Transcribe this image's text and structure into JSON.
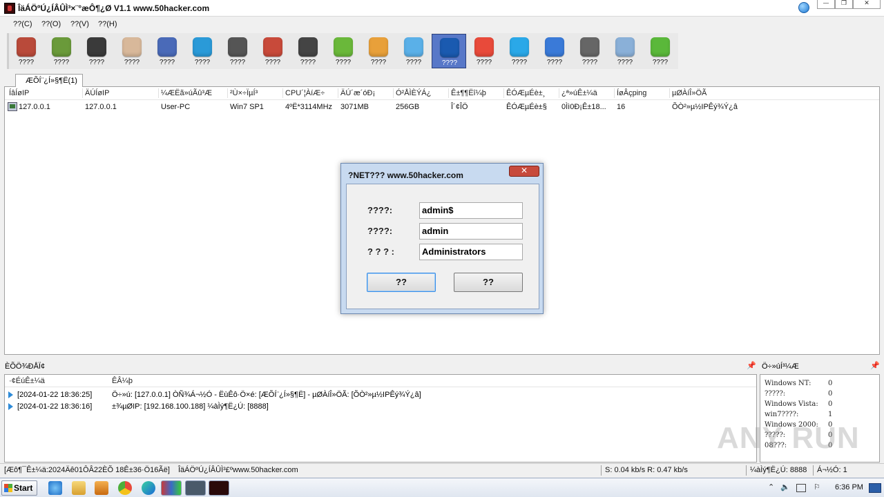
{
  "window": {
    "title": "ÎäÁÖºÚ¿ÍÂÛÌ³×¨°æÔ¶¿Ø V1.1 www.50hacker.com",
    "minimize": "—",
    "maximize": "❐",
    "close": "✕"
  },
  "menu": [
    "??(C)",
    "??(O)",
    "??(V)",
    "??(H)"
  ],
  "toolbar": {
    "items": [
      {
        "label": "????",
        "icon": "font-icon",
        "color": "#b94a3a"
      },
      {
        "label": "????",
        "icon": "drive-icon",
        "color": "#6a9a3a"
      },
      {
        "label": "????",
        "icon": "terminal-icon",
        "color": "#3a3a3a"
      },
      {
        "label": "????",
        "icon": "calculator-icon",
        "color": "#d8b89a"
      },
      {
        "label": "????",
        "icon": "activity-monitor-icon",
        "color": "#4a6ab8"
      },
      {
        "label": "????",
        "icon": "app-store-icon",
        "color": "#2a9ad8"
      },
      {
        "label": "????",
        "icon": "camera-icon",
        "color": "#555555"
      },
      {
        "label": "????",
        "icon": "microphone-icon",
        "color": "#c84a3a"
      },
      {
        "label": "????",
        "icon": "clock-icon",
        "color": "#444444"
      },
      {
        "label": "????",
        "icon": "download-icon",
        "color": "#6ab83a"
      },
      {
        "label": "????",
        "icon": "star-icon",
        "color": "#e8a03a"
      },
      {
        "label": "????",
        "icon": "cloud-icon",
        "color": "#5ab0e8"
      },
      {
        "label": "????",
        "icon": "chat-icon",
        "color": "#1a5ab0",
        "selected": true
      },
      {
        "label": "????",
        "icon": "calendar-icon",
        "color": "#e84a3a"
      },
      {
        "label": "????",
        "icon": "skype-icon",
        "color": "#2aa8e8"
      },
      {
        "label": "????",
        "icon": "globe-icon",
        "color": "#3a7ad8"
      },
      {
        "label": "????",
        "icon": "settings-icon",
        "color": "#666666"
      },
      {
        "label": "????",
        "icon": "checklist-icon",
        "color": "#8ab0d8"
      },
      {
        "label": "????",
        "icon": "phone-icon",
        "color": "#5ab83a"
      }
    ]
  },
  "tab": {
    "label": "ÆÕÍ¨¿Í»§¶Ë(1)"
  },
  "clients": {
    "columns": [
      "ÍâÍøIP",
      "ÄÚÍøIP",
      "¼ÆËã»úÃû³Æ",
      "²Ù×÷ÏµÍ³",
      "CPU´¦ÀíÆ÷",
      "ÄÚ´æ´óÐ¡",
      "Ó²ÅÌÈÝÁ¿",
      "Ê±¶¶Ëî¼þ",
      "ÊÓÆµÉè±¸",
      "¿ª»úÊ±¼ä",
      "ÍøÂçping",
      "µØÀíÎ»ÖÃ"
    ],
    "rows": [
      [
        "127.0.0.1",
        "127.0.0.1",
        "User-PC",
        "Win7 SP1",
        "4ºË*3114MHz",
        "3071MB",
        "256GB",
        "Î´¢ÎÖ",
        "ÊÓÆµÉè±§",
        "0Ìì0Ð¡Ê±18...",
        "16",
        "ÕÒ²»µ½IPÊý¾Ý¿â"
      ]
    ]
  },
  "dialog": {
    "title": "?NET??? www.50hacker.com",
    "close": "✕",
    "fields": [
      {
        "label": "????:",
        "value": "admin$"
      },
      {
        "label": "????:",
        "value": "admin"
      },
      {
        "label": "? ?  ? :",
        "value": "Administrators"
      }
    ],
    "ok_label": "??",
    "cancel_label": "??"
  },
  "log": {
    "title": "ÈÕÖ¾ÐÅÏ¢",
    "pin": "📌",
    "columns": [
      "·¢ÉúÊ±¼ä",
      "ÊÂ¼þ"
    ],
    "rows": [
      {
        "time": "[2024-01-22 18:36:25]",
        "msg": "Ö÷»ú: [127.0.0.1] ÒÑ¾­Á¬½Ó - ËùÊô·Ö×é: [ÆÕÍ¨¿Í»§¶Ë] - µØÀíÎ»ÖÃ: [ÕÒ²»µ½IPÊý¾Ý¿â]"
      },
      {
        "time": "[2024-01-22 18:36:16]",
        "msg": "±¾µØIP: [192.168.100.188] ¼àÌý¶Ë¿Ú: [8888]"
      }
    ]
  },
  "stats": {
    "title": "Ö÷»úÍ³¼Æ",
    "pin": "📌",
    "rows": [
      {
        "label": "Windows NT:",
        "value": "0"
      },
      {
        "label": "?????:",
        "value": "0"
      },
      {
        "label": "Windows Vista:",
        "value": "0"
      },
      {
        "label": "win7????:",
        "value": "1"
      },
      {
        "label": "Windows 2000:",
        "value": "0"
      },
      {
        "label": "?????:",
        "value": "0"
      },
      {
        "label": "08???:",
        "value": "0"
      }
    ]
  },
  "statusbar": {
    "left": "[Æô¶¯Ê±¼ä:2024Äê01ÔÂ22ÈÕ 18Ê±36·Ö16Ãë]",
    "site": "ÎäÁÖºÚ¿ÍÂÛÌ³£ºwww.50hacker.com",
    "speed": "S: 0.04 kb/s R: 0.47 kb/s",
    "port": "¼àÌý¶Ë¿Ú: 8888",
    "online": "Á¬½Ó: 1"
  },
  "taskbar": {
    "start": "Start",
    "clock": "6:36 PM",
    "tray_up": "⌃",
    "speaker": "🔈",
    "flag": "⚐"
  },
  "watermark": "ANY RUN"
}
